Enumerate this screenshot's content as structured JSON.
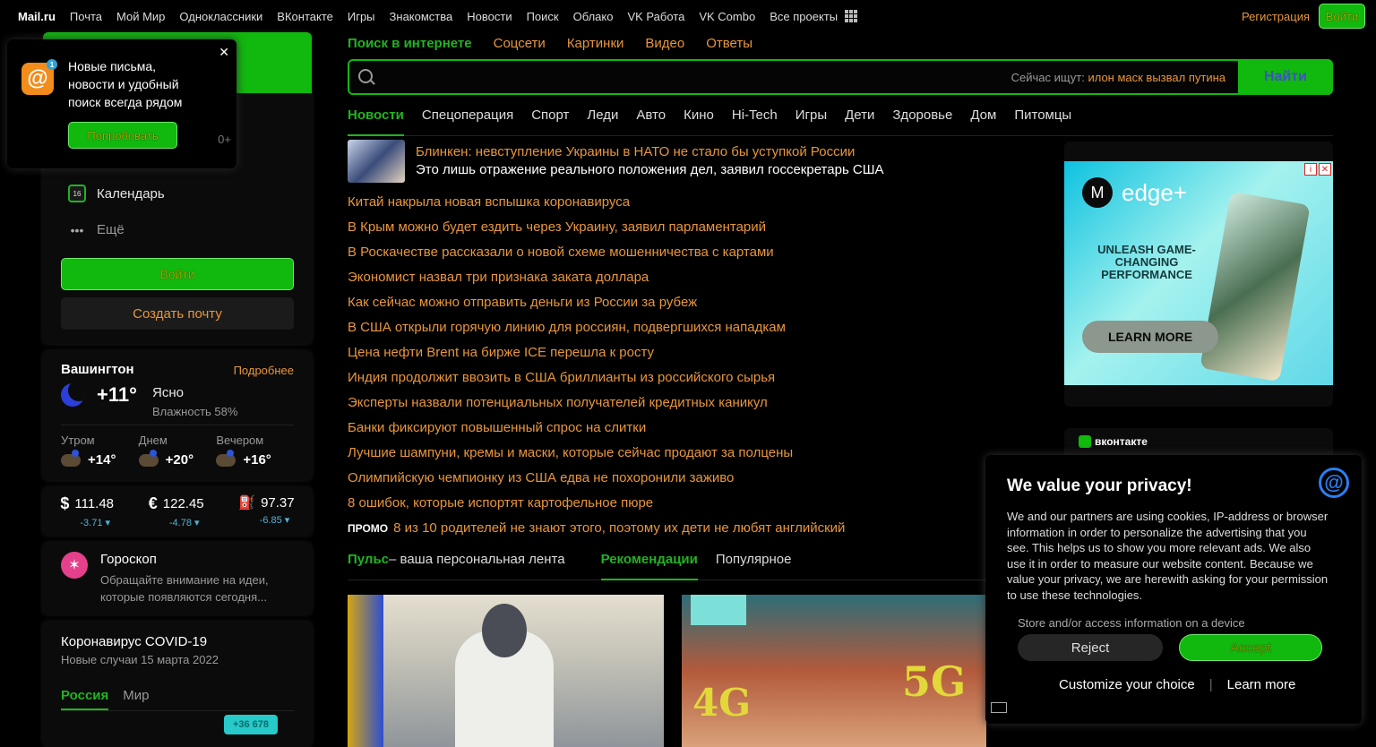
{
  "topnav": {
    "logo": "Mail.ru",
    "links": [
      "Почта",
      "Мой Мир",
      "Одноклассники",
      "ВКонтакте",
      "Игры",
      "Знакомства",
      "Новости",
      "Поиск",
      "Облако",
      "VK Работа",
      "VK Combo",
      "Все проекты"
    ],
    "register": "Регистрация",
    "login": "Войти"
  },
  "popup": {
    "text": "Новые письма, новости и удобный поиск всегда рядом",
    "badge": "1",
    "button": "Попробовать",
    "count": "0+"
  },
  "mail": {
    "calendar": "Календарь",
    "more": "Ещё",
    "login": "Войти",
    "create": "Создать почту"
  },
  "weather": {
    "city": "Вашингтон",
    "more": "Подробнее",
    "temp": "+11°",
    "condition": "Ясно",
    "humidity": "Влажность 58%",
    "parts": [
      {
        "label": "Утром",
        "temp": "+14°"
      },
      {
        "label": "Днем",
        "temp": "+20°"
      },
      {
        "label": "Вечером",
        "temp": "+16°"
      }
    ]
  },
  "rates": [
    {
      "symbol": "$",
      "value": "111.48",
      "delta": "-3.71 ▾"
    },
    {
      "symbol": "€",
      "value": "122.45",
      "delta": "-4.78 ▾"
    },
    {
      "symbol": "⛽",
      "value": "97.37",
      "delta": "-6.85 ▾"
    }
  ],
  "horoscope": {
    "title": "Гороскоп",
    "text": "Обращайте внимание на идеи, которые появляются сегодня..."
  },
  "covid": {
    "title": "Коронавирус COVID-19",
    "subtitle": "Новые случаи 15 марта 2022",
    "tabs": [
      "Россия",
      "Мир"
    ],
    "badge": "+36 678"
  },
  "search": {
    "tabs": [
      "Поиск в интернете",
      "Соцсети",
      "Картинки",
      "Видео",
      "Ответы"
    ],
    "placeholder": "",
    "hint_label": "Сейчас ищут:",
    "hint_query": "илон маск вызвал путина",
    "button": "Найти"
  },
  "categories": [
    "Новости",
    "Спецоперация",
    "Спорт",
    "Леди",
    "Авто",
    "Кино",
    "Hi-Tech",
    "Игры",
    "Дети",
    "Здоровье",
    "Дом",
    "Питомцы"
  ],
  "topnews": {
    "title": "Блинкен: невступление Украины в НАТО не стало бы уступкой России",
    "desc": "Это лишь отражение реального положения дел, заявил госсекретарь США"
  },
  "news": [
    "Китай накрыла новая вспышка коронавируса",
    "В Крым можно будет ездить через Украину, заявил парламентарий",
    "В Роскачестве рассказали о новой схеме мошенничества с картами",
    "Экономист назвал три признака заката доллара",
    "Как сейчас можно отправить деньги из России за рубеж",
    "В США открыли горячую линию для россиян, подвергшихся нападкам",
    "Цена нефти Brent на бирже ICE перешла к росту",
    "Индия продолжит ввозить в США бриллианты из российского сырья",
    "Эксперты назвали потенциальных получателей кредитных каникул",
    "Банки фиксируют повышенный спрос на слитки",
    "Лучшие шампуни, кремы и маски, которые сейчас продают за полцены",
    "Олимпийскую чемпионку из США едва не похоронили заживо",
    "8 ошибок, которые испортят картофельное пюре"
  ],
  "promo": {
    "label": "ПРОМО",
    "text": "8 из 10 родителей не знают этого, поэтому их дети не любят английский"
  },
  "feed": {
    "pulse": "Пульс",
    "pulse_desc": " – ваша персональная лента",
    "recommend": "Рекомендации",
    "popular": "Популярное",
    "img2_left": "4G",
    "img2_right": "5G"
  },
  "ad": {
    "brand": "edge+",
    "brand_logo": "M",
    "headline": "UNLEASH GAME-CHANGING PERFORMANCE",
    "button": "LEARN MORE",
    "info": "i",
    "close": "✕",
    "vk": "вконтакте"
  },
  "privacy": {
    "title": "We value your privacy!",
    "logo": "@",
    "text": "We and our partners are using cookies, IP-address or browser information in order to personalize the advertising that you see. This helps us to show you more relevant ads. We also use it in order to measure our website content. Because we value your privacy, we are herewith asking for your permission to use these technologies.",
    "store": "Store and/or access information on a device",
    "reject": "Reject",
    "accept": "Accept",
    "customize": "Customize your choice",
    "separator": "|",
    "learn": "Learn more"
  }
}
